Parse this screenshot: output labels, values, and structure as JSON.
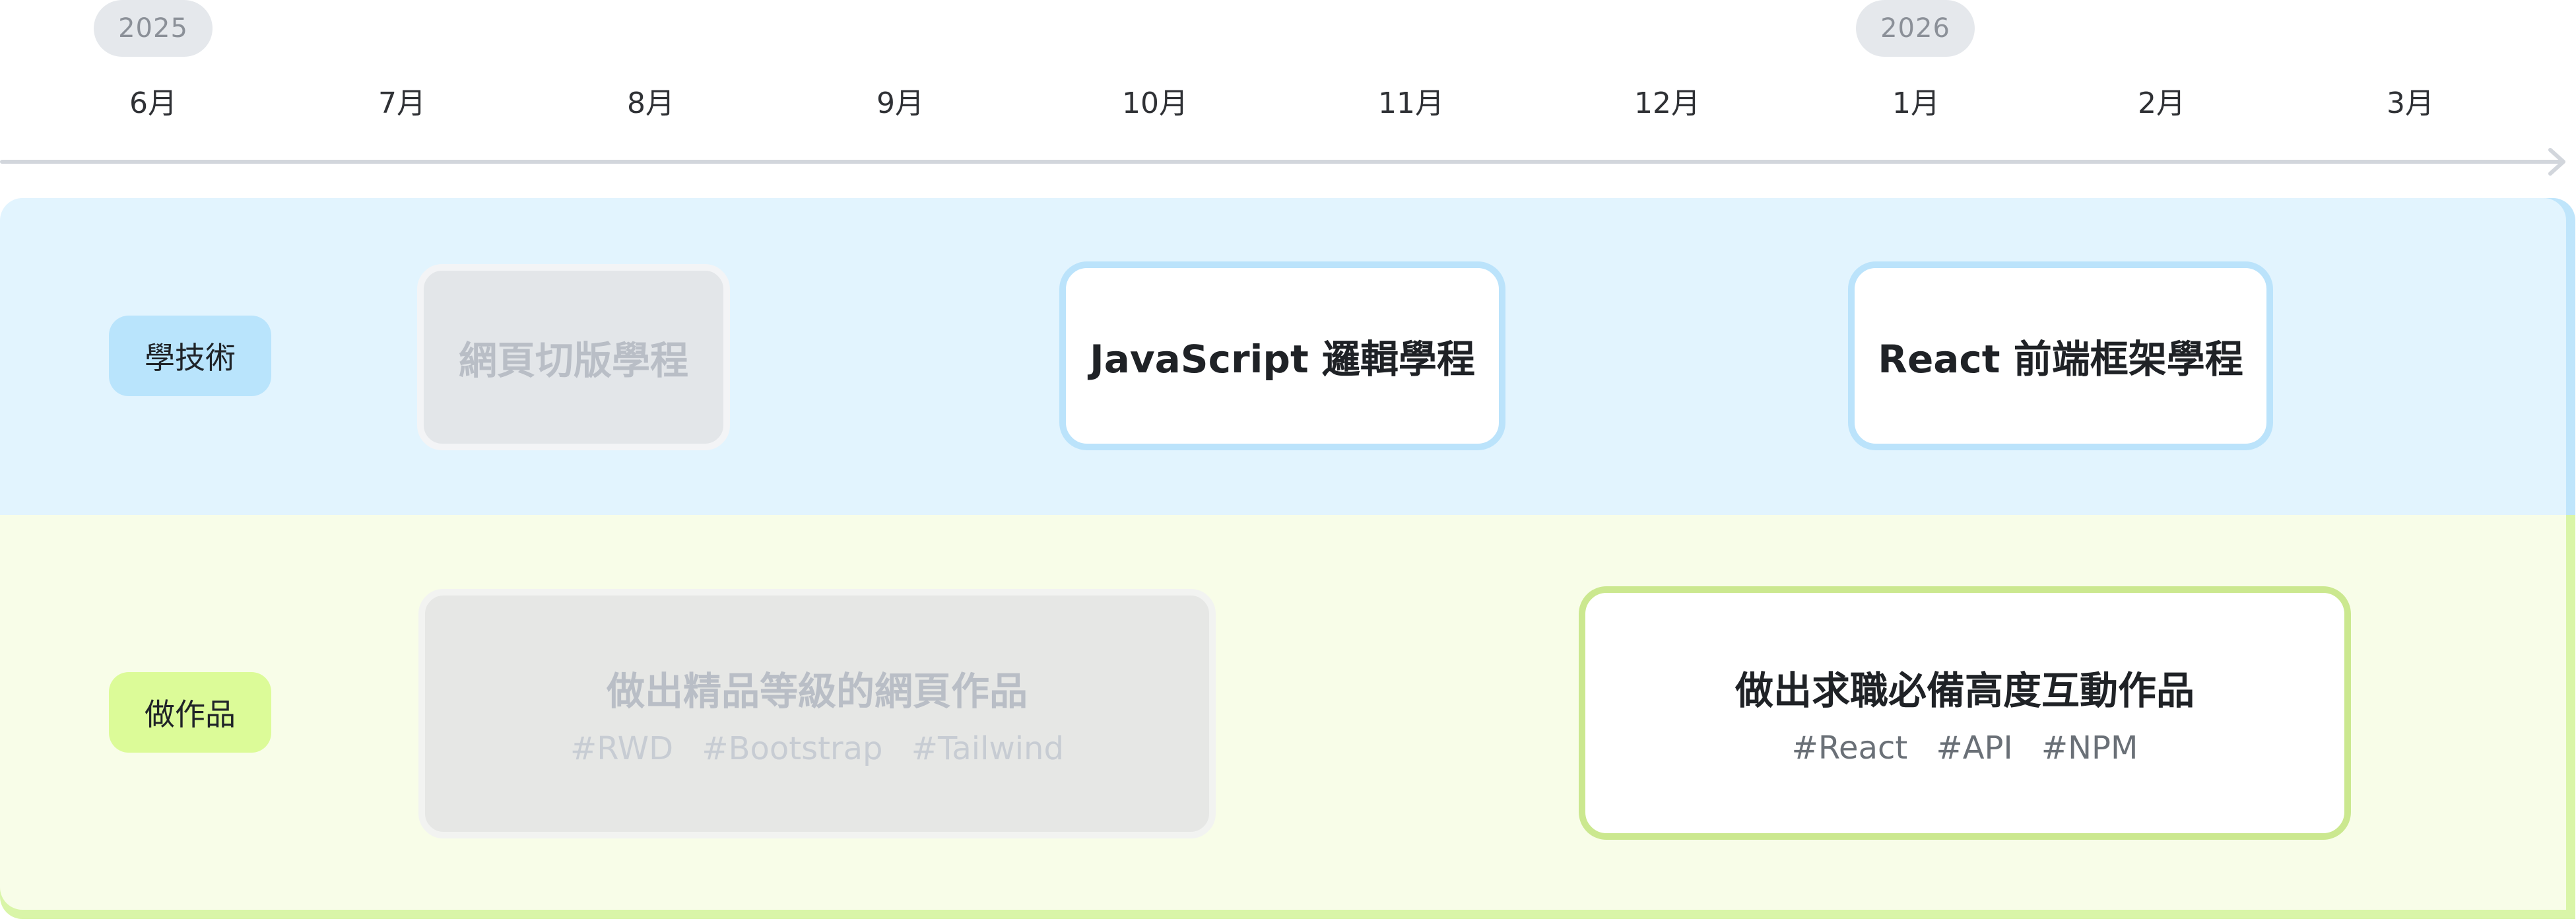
{
  "timeline": {
    "years": [
      "2025",
      "2026"
    ],
    "months": [
      "6月",
      "7月",
      "8月",
      "9月",
      "10月",
      "11月",
      "12月",
      "1月",
      "2月",
      "3月"
    ]
  },
  "lanes": [
    {
      "label": "學技術",
      "color": "#e2f4fe",
      "items": [
        {
          "title": "網頁切版學程",
          "status": "done"
        },
        {
          "title": "JavaScript 邏輯學程",
          "status": "active"
        },
        {
          "title": "React 前端框架學程",
          "status": "active"
        }
      ]
    },
    {
      "label": "做作品",
      "color": "#f8fde8",
      "items": [
        {
          "title": "做出精品等級的網頁作品",
          "tags": [
            "#RWD",
            "#Bootstrap",
            "#Tailwind"
          ],
          "status": "done"
        },
        {
          "title": "做出求職必備高度互動作品",
          "tags": [
            "#React",
            "#API",
            "#NPM"
          ],
          "status": "active"
        }
      ]
    }
  ],
  "colors": {
    "accent_blue": "#bbe3fb",
    "accent_green": "#cbe88f",
    "done_gray": "#e3e6e9"
  }
}
